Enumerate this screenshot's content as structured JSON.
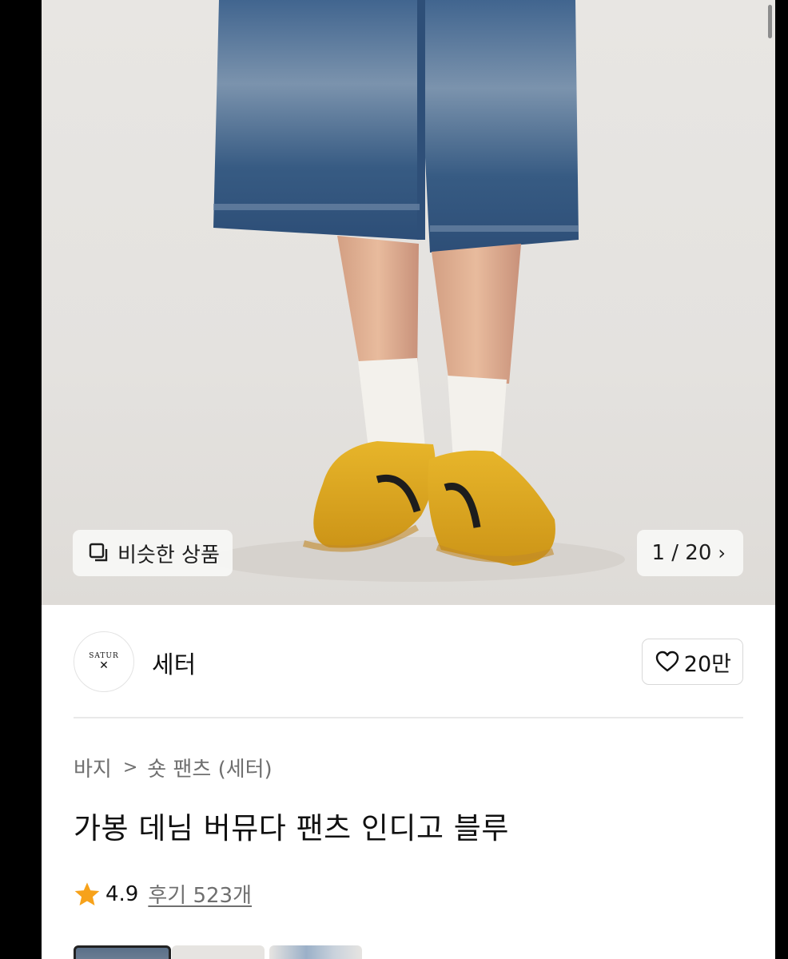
{
  "hero": {
    "similar_label": "비슷한 상품",
    "page_indicator": "1 / 20",
    "chevron": "›"
  },
  "brand": {
    "name": "세터",
    "logo_text": "SATUR",
    "likes": "20만"
  },
  "breadcrumb": {
    "category": "바지",
    "separator": ">",
    "subcategory": "숏 팬츠 (세터)"
  },
  "product": {
    "title": "가봉 데님 버뮤다 팬츠 인디고 블루",
    "rating": "4.9",
    "reviews": "후기 523개"
  },
  "colors": {
    "star": "#f7a21a",
    "text": "#111111",
    "muted": "#6f6f6f"
  },
  "icons": {
    "similar": "copy-squares-icon",
    "like": "heart-outline-icon",
    "rating": "star-icon"
  }
}
